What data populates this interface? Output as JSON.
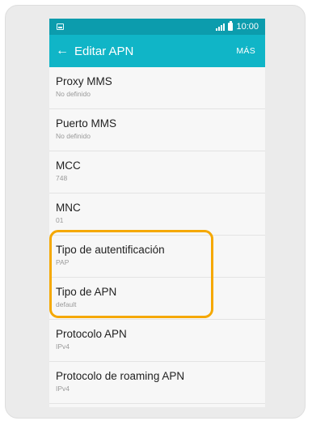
{
  "status_bar": {
    "time": "10:00"
  },
  "app_bar": {
    "title": "Editar APN",
    "more_label": "MÁS"
  },
  "items": [
    {
      "label": "Proxy MMS",
      "value": "No definido"
    },
    {
      "label": "Puerto MMS",
      "value": "No definido"
    },
    {
      "label": "MCC",
      "value": "748"
    },
    {
      "label": "MNC",
      "value": "01"
    },
    {
      "label": "Tipo de autentificación",
      "value": "PAP"
    },
    {
      "label": "Tipo de APN",
      "value": "default"
    },
    {
      "label": "Protocolo APN",
      "value": "IPv4"
    },
    {
      "label": "Protocolo de roaming APN",
      "value": "IPv4"
    }
  ],
  "colors": {
    "app_bar": "#10b5c7",
    "status_bar": "#0c9cad",
    "highlight": "#f5a800"
  }
}
